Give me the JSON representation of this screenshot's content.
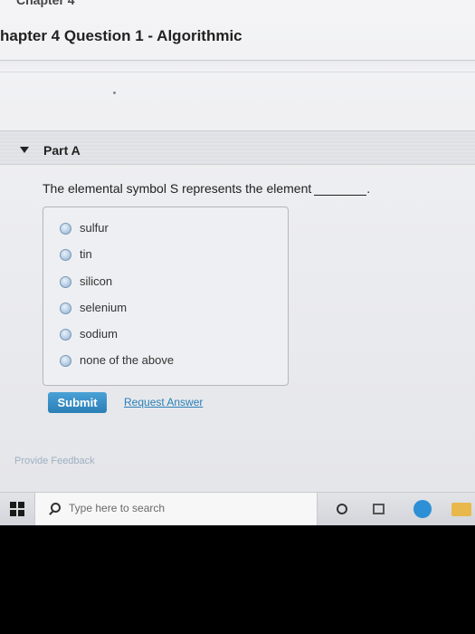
{
  "header": {
    "breadcrumb": "Chapter 4",
    "title": "hapter 4 Question 1 - Algorithmic"
  },
  "part": {
    "label": "Part A",
    "question": "The elemental symbol S represents the element",
    "question_suffix": "."
  },
  "options": [
    {
      "label": "sulfur"
    },
    {
      "label": "tin"
    },
    {
      "label": "silicon"
    },
    {
      "label": "selenium"
    },
    {
      "label": "sodium"
    },
    {
      "label": "none of the above"
    }
  ],
  "actions": {
    "submit_label": "Submit",
    "request_answer_label": "Request Answer",
    "feedback_label": "Provide Feedback"
  },
  "taskbar": {
    "search_placeholder": "Type here to search"
  },
  "colors": {
    "accent": "#2a7fb6",
    "submit_bg": "#3a90c8"
  }
}
